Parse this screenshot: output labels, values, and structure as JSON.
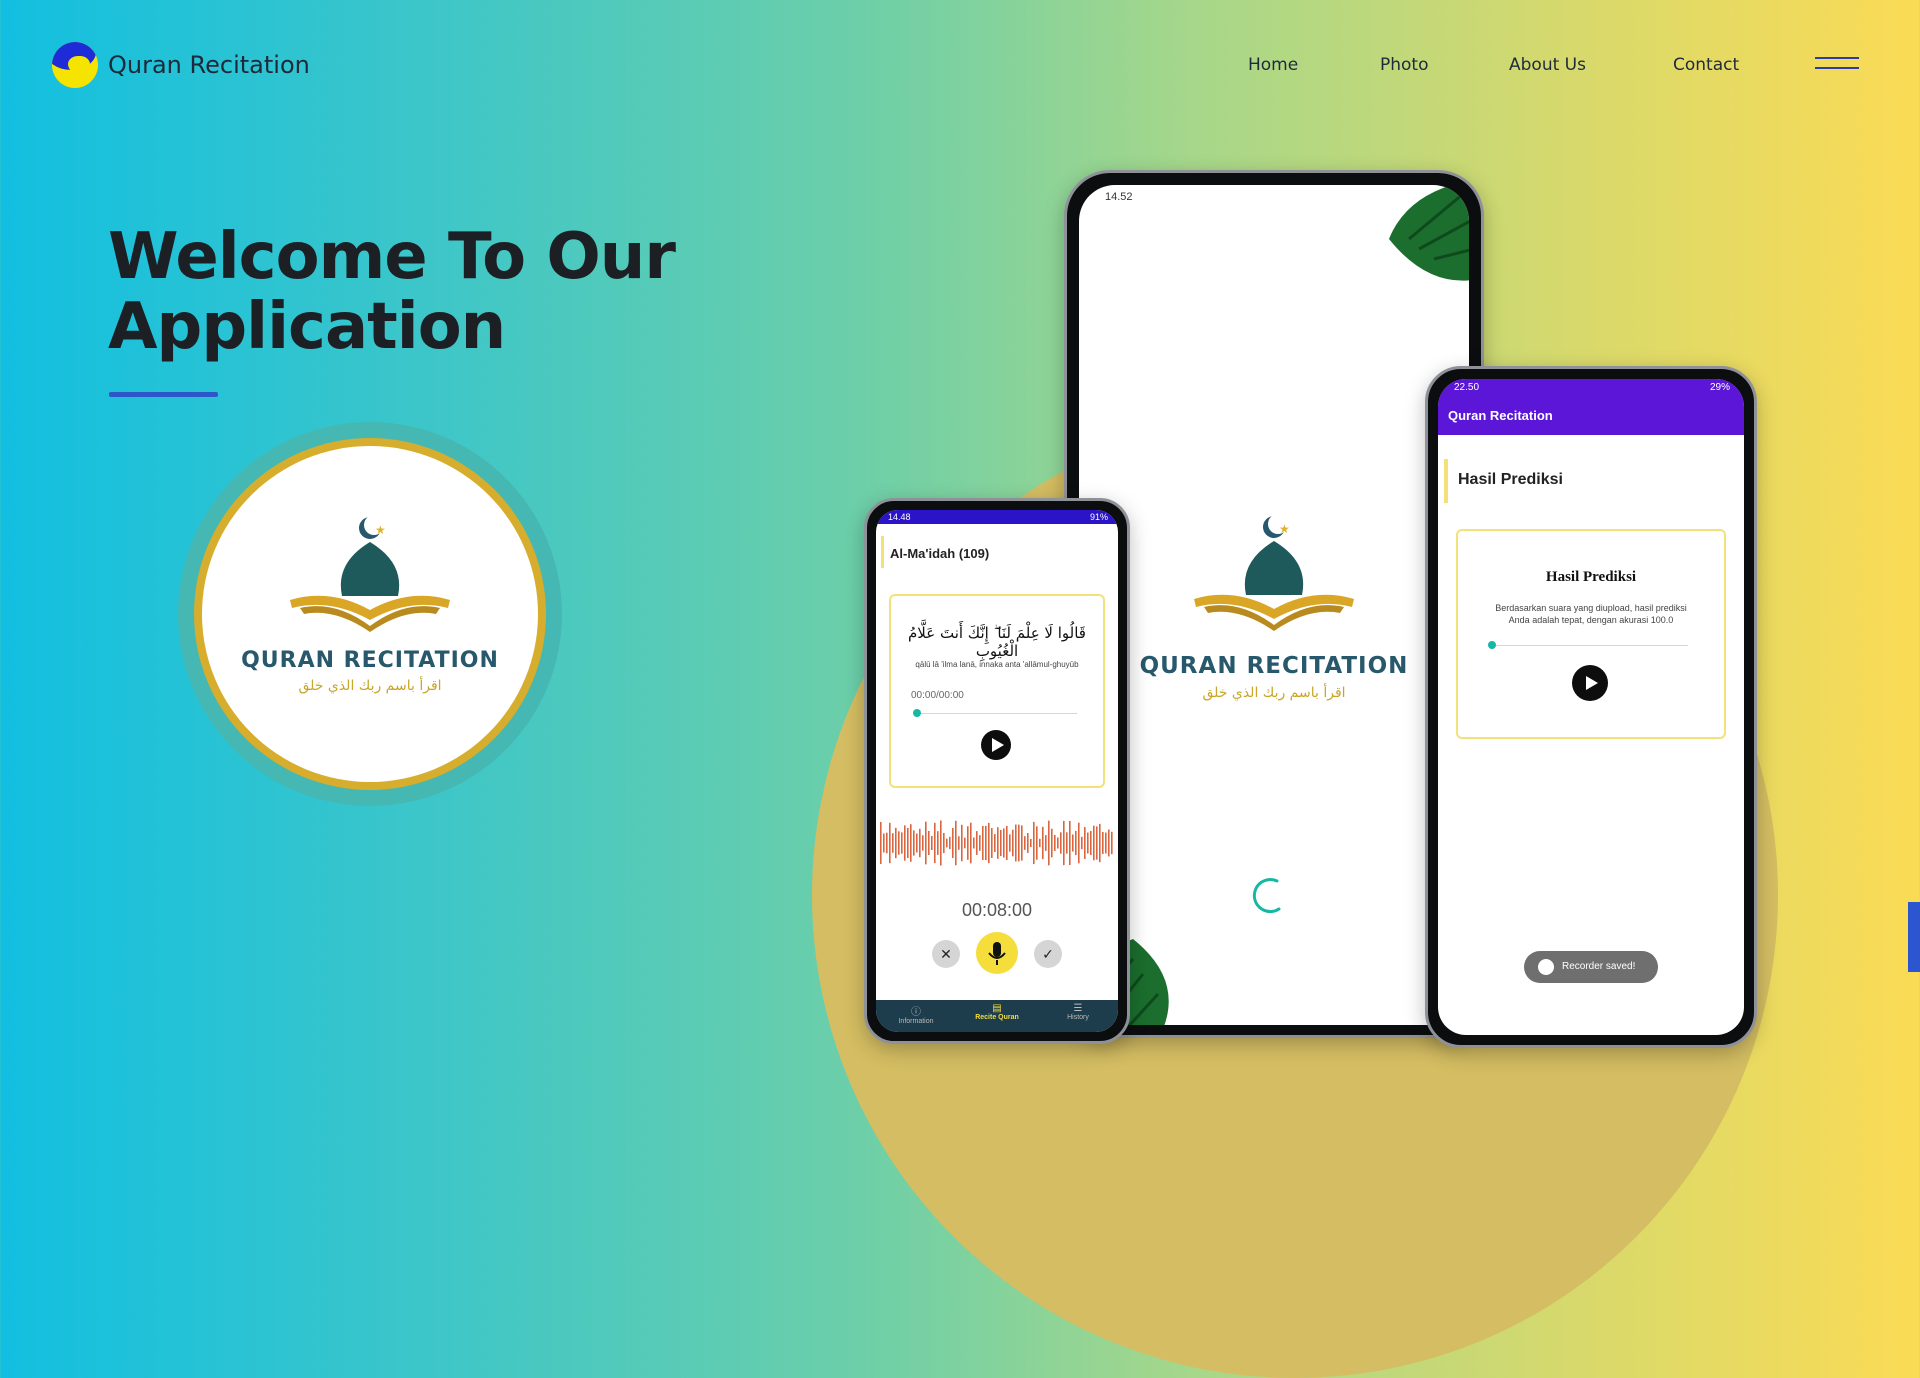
{
  "header": {
    "brand_title": "Quran Recitation",
    "nav": [
      "Home",
      "Photo",
      "About Us",
      "Contact"
    ]
  },
  "hero": {
    "title_line1": "Welcome To Our",
    "title_line2": "Application"
  },
  "logo": {
    "name": "QURAN RECITATION",
    "arabic": "اقرأ باسم ربك الذي خلق"
  },
  "phone_left": {
    "status_time": "14.48",
    "status_battery": "91%",
    "surah": "Al-Ma'idah (109)",
    "arabic_verse": "قَالُوا لَا عِلْمَ لَنَا ۖ إِنَّكَ أَنتَ عَلَّامُ الْغُيُوبِ",
    "transliteration": "qālū lā 'ilma lanā, innaka anta 'allāmul-ghuyūb",
    "time_progress": "00:00/00:00",
    "record_timer": "00:08:00",
    "bottom_nav": [
      "Information",
      "Recite Quran",
      "History"
    ]
  },
  "phone_center": {
    "status_time": "14.52",
    "app_name": "QURAN RECITATION",
    "arabic": "اقرأ باسم ربك الذي خلق"
  },
  "phone_right": {
    "status_time": "22.50",
    "status_battery": "29%",
    "app_bar_title": "Quran Recitation",
    "section_title": "Hasil Prediksi",
    "card_title": "Hasil Prediksi",
    "card_text_line1": "Berdasarkan suara yang diupload, hasil prediksi",
    "card_text_line2": "Anda adalah tepat, dengan akurasi 100.0",
    "toast": "Recorder saved!"
  },
  "colors": {
    "accent_blue": "#2d56c9",
    "app_purple": "#5b16d8",
    "gold": "#d6ad2c",
    "teal": "#16b8a4",
    "record_yellow": "#f5dd3c"
  }
}
